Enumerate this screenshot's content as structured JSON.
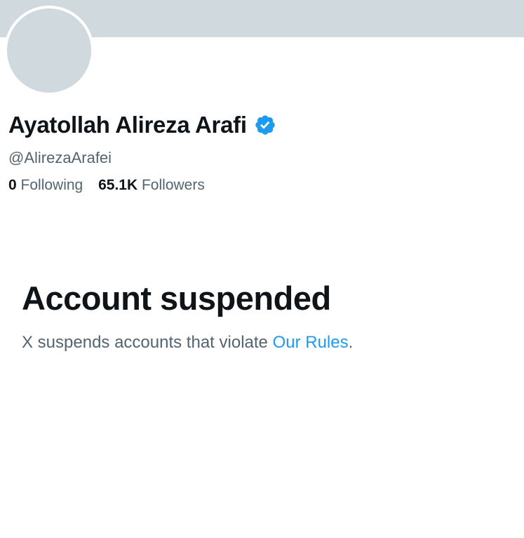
{
  "profile": {
    "display_name": "Ayatollah Alireza Arafi",
    "handle": "@AlirezaArafei",
    "verified_icon": "verified-badge-icon",
    "following_count": "0",
    "following_label": "Following",
    "followers_count": "65.1K",
    "followers_label": "Followers"
  },
  "suspension": {
    "title": "Account suspended",
    "message_prefix": "X suspends accounts that violate ",
    "rules_link": "Our Rules",
    "message_suffix": "."
  },
  "colors": {
    "banner": "#cfd9de",
    "avatar_placeholder": "#cfd9de",
    "primary_text": "#0f1419",
    "secondary_text": "#536471",
    "link": "#1d9bf0",
    "verified_badge": "#1d9bf0"
  }
}
